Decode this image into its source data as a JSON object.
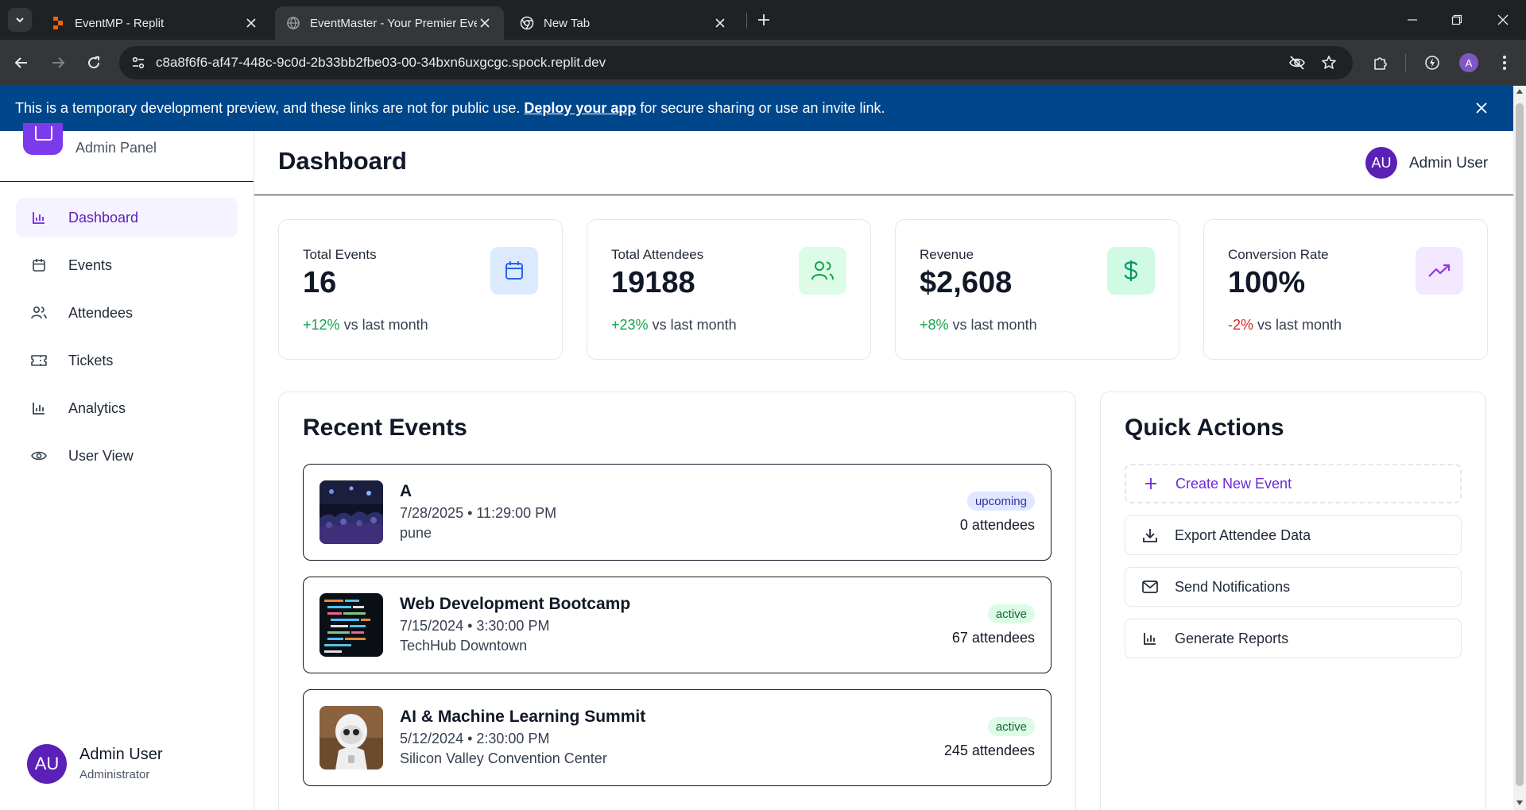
{
  "browser": {
    "tabs": [
      {
        "title": "EventMP - Replit",
        "active": false
      },
      {
        "title": "EventMaster - Your Premier Eve",
        "active": true
      },
      {
        "title": "New Tab",
        "active": false
      }
    ],
    "url": "c8a8f6f6-af47-448c-9c0d-2b33bb2fbe03-00-34bxn6uxgcgc.spock.replit.dev",
    "profile_initial": "A"
  },
  "banner": {
    "text_before": "This is a temporary development preview, and these links are not for public use.",
    "link_text": "Deploy your app",
    "text_after": "for secure sharing or use an invite link."
  },
  "sidebar": {
    "subtitle": "Admin Panel",
    "items": [
      {
        "label": "Dashboard",
        "icon": "bar-chart-icon",
        "active": true
      },
      {
        "label": "Events",
        "icon": "calendar-icon",
        "active": false
      },
      {
        "label": "Attendees",
        "icon": "users-icon",
        "active": false
      },
      {
        "label": "Tickets",
        "icon": "ticket-icon",
        "active": false
      },
      {
        "label": "Analytics",
        "icon": "bar-chart-icon",
        "active": false
      },
      {
        "label": "User View",
        "icon": "eye-icon",
        "active": false
      }
    ],
    "user": {
      "initials": "AU",
      "name": "Admin User",
      "role": "Administrator"
    }
  },
  "header": {
    "title": "Dashboard",
    "user": {
      "initials": "AU",
      "name": "Admin User"
    }
  },
  "stats": [
    {
      "label": "Total Events",
      "value": "16",
      "change": "+12%",
      "change_suffix": "vs last month",
      "trend": "positive",
      "icon": "calendar-icon",
      "icon_bg": "#dbeafe",
      "icon_color": "#2563eb"
    },
    {
      "label": "Total Attendees",
      "value": "19188",
      "change": "+23%",
      "change_suffix": "vs last month",
      "trend": "positive",
      "icon": "users-icon",
      "icon_bg": "#dcfce7",
      "icon_color": "#16a34a"
    },
    {
      "label": "Revenue",
      "value": "$2,608",
      "change": "+8%",
      "change_suffix": "vs last month",
      "trend": "positive",
      "icon": "dollar-icon",
      "icon_bg": "#d1fae5",
      "icon_color": "#059669"
    },
    {
      "label": "Conversion Rate",
      "value": "100%",
      "change": "-2%",
      "change_suffix": "vs last month",
      "trend": "negative",
      "icon": "trending-up-icon",
      "icon_bg": "#f3e8ff",
      "icon_color": "#9333ea"
    }
  ],
  "recent_events": {
    "title": "Recent Events",
    "items": [
      {
        "title": "A",
        "datetime": "7/28/2025 • 11:29:00 PM",
        "location": "pune",
        "status": "upcoming",
        "attendees": "0 attendees",
        "thumb": "concert-crowd"
      },
      {
        "title": "Web Development Bootcamp",
        "datetime": "7/15/2024 • 3:30:00 PM",
        "location": "TechHub Downtown",
        "status": "active",
        "attendees": "67 attendees",
        "thumb": "code-screen"
      },
      {
        "title": "AI & Machine Learning Summit",
        "datetime": "5/12/2024 • 2:30:00 PM",
        "location": "Silicon Valley Convention Center",
        "status": "active",
        "attendees": "245 attendees",
        "thumb": "robot"
      }
    ]
  },
  "quick_actions": {
    "title": "Quick Actions",
    "items": [
      {
        "label": "Create New Event",
        "icon": "plus-icon",
        "style": "dashed"
      },
      {
        "label": "Export Attendee Data",
        "icon": "download-icon",
        "style": "solid"
      },
      {
        "label": "Send Notifications",
        "icon": "mail-icon",
        "style": "solid"
      },
      {
        "label": "Generate Reports",
        "icon": "bar-chart-icon",
        "style": "solid"
      }
    ]
  },
  "colors": {
    "accent": "#7c3aed",
    "banner": "#00468b",
    "positive": "#16a34a",
    "negative": "#dc2626"
  }
}
